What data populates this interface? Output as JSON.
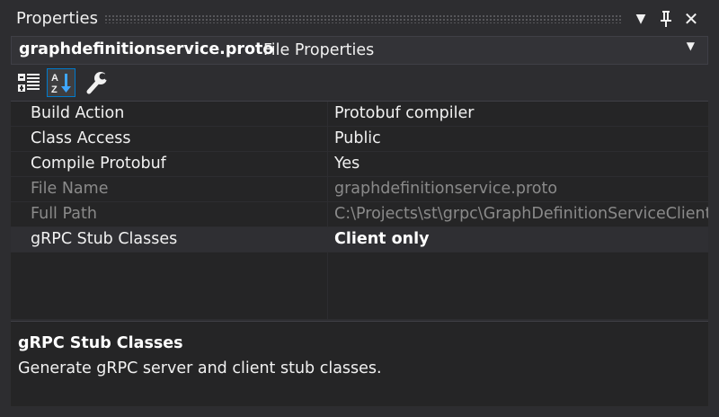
{
  "window": {
    "title": "Properties"
  },
  "object_selector": {
    "name": "graphdefinitionservice.proto",
    "type": "File Properties"
  },
  "toolbar": {
    "buttons": [
      {
        "icon": "categorized-icon",
        "active": false
      },
      {
        "icon": "alphabetical-sort-icon",
        "active": true
      },
      {
        "icon": "wrench-icon",
        "active": false
      }
    ]
  },
  "properties": [
    {
      "name": "Build Action",
      "value": "Protobuf compiler",
      "readonly": false,
      "modified": false
    },
    {
      "name": "Class Access",
      "value": "Public",
      "readonly": false,
      "modified": false
    },
    {
      "name": "Compile Protobuf",
      "value": "Yes",
      "readonly": false,
      "modified": false
    },
    {
      "name": "File Name",
      "value": "graphdefinitionservice.proto",
      "readonly": true,
      "modified": false
    },
    {
      "name": "Full Path",
      "value": "C:\\Projects\\st\\grpc\\GraphDefinitionServiceClient\\",
      "readonly": true,
      "modified": false
    },
    {
      "name": "gRPC Stub Classes",
      "value": "Client only",
      "readonly": false,
      "modified": true
    }
  ],
  "description": {
    "title": "gRPC Stub Classes",
    "text": "Generate gRPC server and client stub classes."
  },
  "colors": {
    "panel_bg": "#2d2d30",
    "grid_bg": "#252526",
    "accent": "#007acc",
    "readonly_text": "#8a8a8a"
  }
}
